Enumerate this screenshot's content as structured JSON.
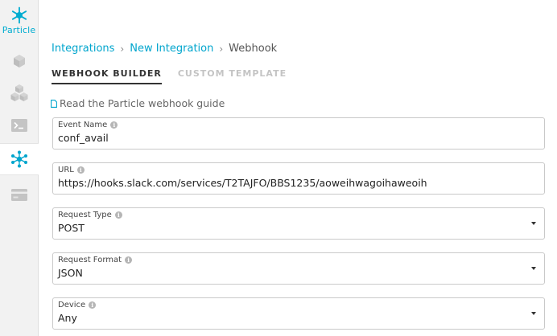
{
  "sidebar": {
    "logo_text": "Particle",
    "items": [
      {
        "icon": "cube-icon",
        "active": false
      },
      {
        "icon": "cubes-icon",
        "active": false
      },
      {
        "icon": "terminal-icon",
        "active": false
      },
      {
        "icon": "integrations-icon",
        "active": true
      },
      {
        "icon": "billing-card-icon",
        "active": false
      }
    ]
  },
  "breadcrumb": {
    "items": [
      "Integrations",
      "New Integration",
      "Webhook"
    ],
    "separator": "›"
  },
  "tabs": [
    "WEBHOOK BUILDER",
    "CUSTOM TEMPLATE"
  ],
  "guide_link": "Read the Particle webhook guide",
  "form": {
    "event_name": {
      "label": "Event Name",
      "value": "conf_avail"
    },
    "url": {
      "label": "URL",
      "value": "https://hooks.slack.com/services/T2TAJFO/BBS1235/aoweihwagoihaweoih"
    },
    "request_type": {
      "label": "Request Type",
      "value": "POST"
    },
    "request_format": {
      "label": "Request Format",
      "value": "JSON"
    },
    "device": {
      "label": "Device",
      "value": "Any"
    }
  },
  "colors": {
    "accent": "#00a5cd",
    "sidebar_bg": "#f2f2f2",
    "icon_gray": "#c8c8c8"
  }
}
